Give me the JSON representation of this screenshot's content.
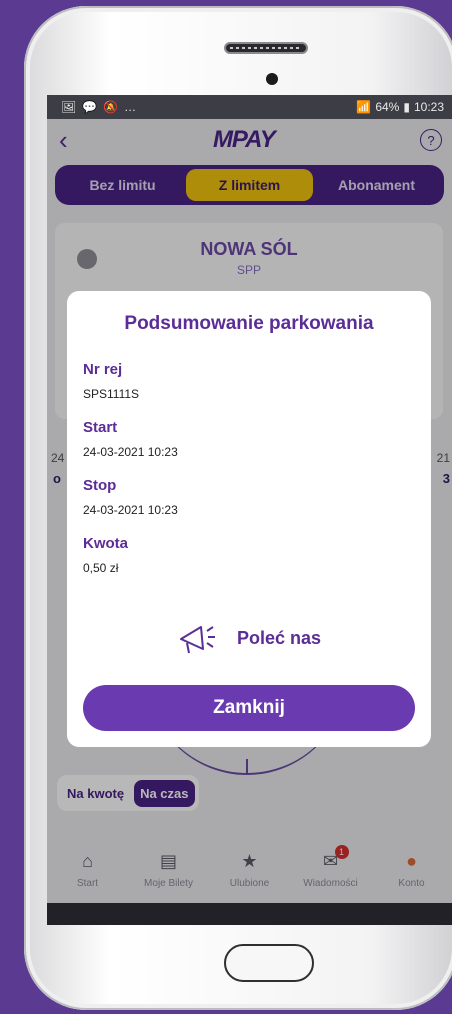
{
  "status_bar": {
    "left_icons": [
      "🖼",
      "💬",
      "🔕",
      "…"
    ],
    "signal_text": "64%",
    "time": "10:23"
  },
  "header": {
    "logo": "MPAY",
    "back_icon": "chevron-left-icon",
    "help_glyph": "?"
  },
  "tabs": [
    {
      "label": "Bez limitu"
    },
    {
      "label": "Z limitem"
    },
    {
      "label": "Abonament"
    }
  ],
  "card": {
    "city": "NOWA SÓL",
    "zone": "SPP"
  },
  "side": {
    "left_top": "24",
    "left_bottom": "o",
    "right_top": "21",
    "right_bottom": "3"
  },
  "mode": {
    "amount": "Na kwotę",
    "time": "Na czas"
  },
  "bottom_nav": [
    {
      "label": "Start",
      "icon": "home-icon"
    },
    {
      "label": "Moje Bilety",
      "icon": "tickets-icon"
    },
    {
      "label": "Ulubione",
      "icon": "star-icon"
    },
    {
      "label": "Wiadomości",
      "icon": "mail-icon",
      "badge": "1"
    },
    {
      "label": "Konto",
      "icon": "user-icon"
    }
  ],
  "modal": {
    "title": "Podsumowanie parkowania",
    "fields": [
      {
        "label": "Nr rej",
        "value": "SPS1111S"
      },
      {
        "label": "Start",
        "value": "24-03-2021 10:23"
      },
      {
        "label": "Stop",
        "value": "24-03-2021 10:23"
      },
      {
        "label": "Kwota",
        "value": "0,50 zł"
      }
    ],
    "recommend": "Poleć nas",
    "close": "Zamknij"
  },
  "colors": {
    "brand": "#4a2386",
    "accent": "#f1c40f",
    "button": "#6a3bb0"
  }
}
